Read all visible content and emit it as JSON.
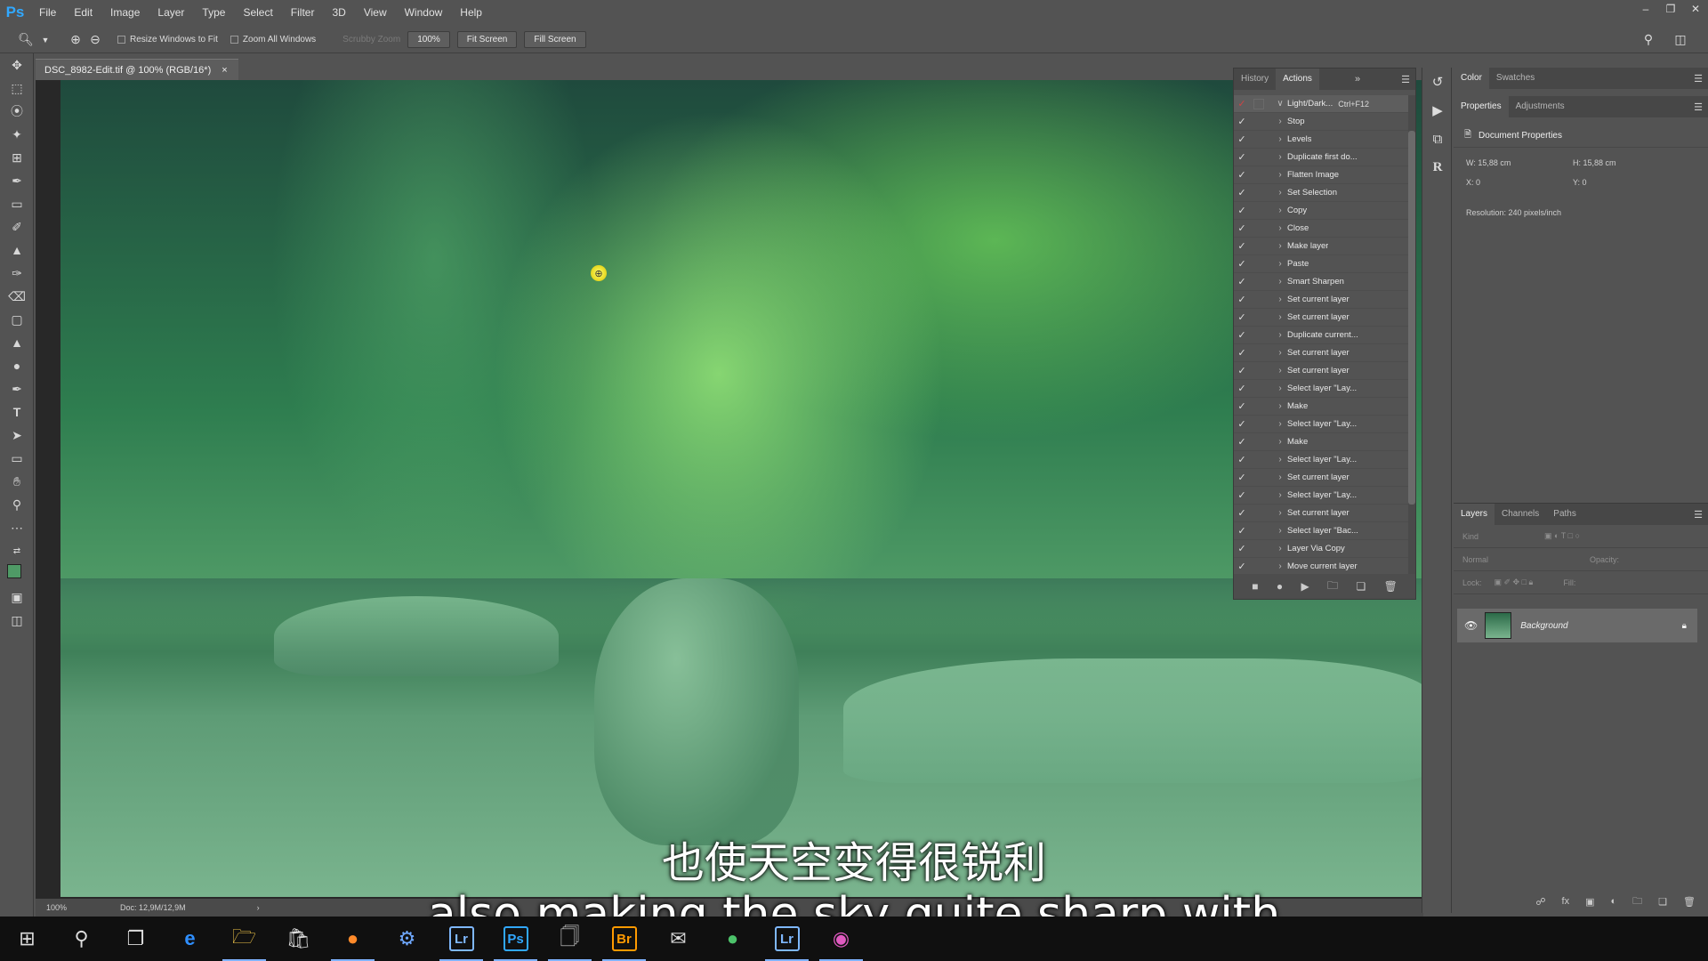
{
  "app": {
    "logo": "Ps",
    "menu": [
      "File",
      "Edit",
      "Image",
      "Layer",
      "Type",
      "Select",
      "Filter",
      "3D",
      "View",
      "Window",
      "Help"
    ],
    "window_controls": [
      "‒",
      "❐",
      "✕"
    ]
  },
  "options_bar": {
    "resize_windows": "Resize Windows to Fit",
    "zoom_all": "Zoom All Windows",
    "scrubby_zoom": "Scrubby Zoom",
    "zoom_value": "100%",
    "fit_screen": "Fit Screen",
    "fill_screen": "Fill Screen"
  },
  "document": {
    "tab_title": "DSC_8982-Edit.tif @ 100% (RGB/16*)",
    "tab_close": "×",
    "zoom": "100%",
    "doc_size": "Doc: 12,9M/12,9M"
  },
  "subtitles": {
    "chinese": "也使天空变得很锐利",
    "english": "also making the sky quite sharp with"
  },
  "actions_panel": {
    "tabs": [
      "History",
      "Actions"
    ],
    "active_tab": "Actions",
    "set_name": "Light/Dark...",
    "set_shortcut": "Ctrl+F12",
    "items": [
      "Stop",
      "Levels",
      "Duplicate first do...",
      "Flatten Image",
      "Set Selection",
      "Copy",
      "Close",
      "Make layer",
      "Paste",
      "Smart Sharpen",
      "Set current layer",
      "Set current layer",
      "Duplicate current...",
      "Set current layer",
      "Set current layer",
      "Select layer \"Lay...",
      "Make",
      "Select layer \"Lay...",
      "Make",
      "Select layer \"Lay...",
      "Set current layer",
      "Select layer \"Lay...",
      "Set current layer",
      "Select layer \"Bac...",
      "Layer Via Copy",
      "Move current layer"
    ]
  },
  "right_panels": {
    "color_tabs": [
      "Color",
      "Swatches"
    ],
    "prop_tabs": [
      "Properties",
      "Adjustments"
    ],
    "doc_props_title": "Document Properties",
    "w": "W: 15,88 cm",
    "h": "H: 15,88 cm",
    "x": "X: 0",
    "y": "Y: 0",
    "resolution": "Resolution: 240 pixels/inch",
    "layer_tabs": [
      "Layers",
      "Channels",
      "Paths"
    ],
    "kind": "Kind",
    "blend_mode": "Normal",
    "opacity": "Opacity:",
    "lock": "Lock:",
    "fill": "Fill:",
    "layer_name": "Background"
  },
  "taskbar": {
    "apps": [
      "Lr",
      "Ps",
      "Br",
      "Lr"
    ]
  }
}
